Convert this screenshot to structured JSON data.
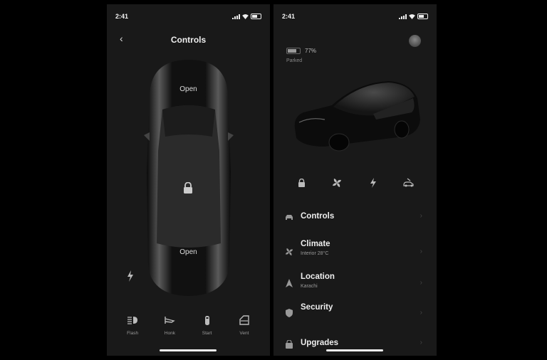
{
  "left_screen": {
    "status": {
      "time": "2:41"
    },
    "header": {
      "back": "‹",
      "title": "Controls"
    },
    "car": {
      "frunk_label": "Open",
      "trunk_label": "Open"
    },
    "actions": [
      {
        "label": "Flash",
        "icon": "headlight-icon"
      },
      {
        "label": "Honk",
        "icon": "horn-icon"
      },
      {
        "label": "Start",
        "icon": "key-fob-icon"
      },
      {
        "label": "Vent",
        "icon": "window-icon"
      }
    ]
  },
  "right_screen": {
    "status": {
      "time": "2:41"
    },
    "battery": {
      "percent_label": "77%",
      "level": 0.77,
      "state": "Parked"
    },
    "quick_actions": [
      "lock-icon",
      "fan-icon",
      "bolt-icon",
      "car-lift-icon"
    ],
    "menu": [
      {
        "label": "Controls",
        "sub": "",
        "icon": "car-icon"
      },
      {
        "label": "Climate",
        "sub": "Interior 28°C",
        "icon": "fan-icon"
      },
      {
        "label": "Location",
        "sub": "Karachi",
        "icon": "navigation-arrow-icon"
      },
      {
        "label": "Security",
        "sub": "",
        "icon": "shield-icon"
      },
      {
        "label": "Upgrades",
        "sub": "",
        "icon": "bag-icon"
      }
    ],
    "chevron": "›"
  },
  "colors": {
    "panel": "#191919",
    "background": "#000000",
    "text": "#e6e6e6",
    "muted": "#999999"
  }
}
